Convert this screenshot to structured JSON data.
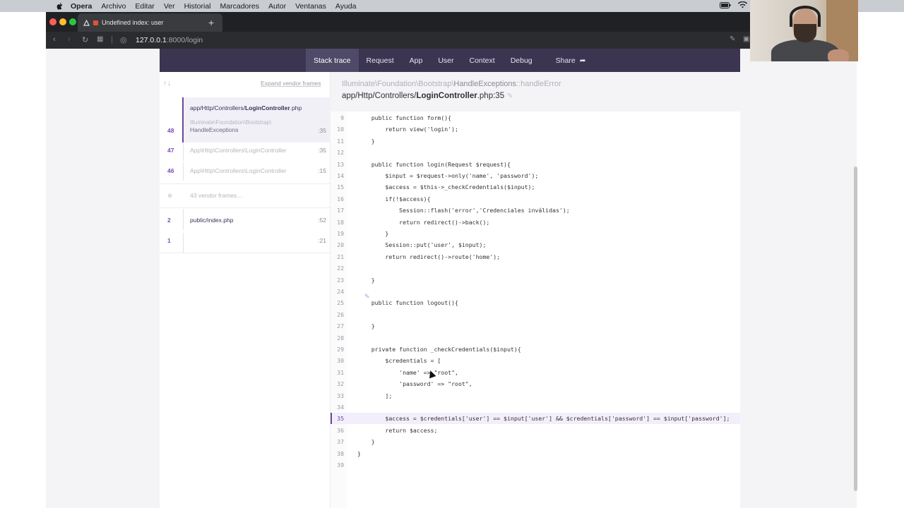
{
  "menubar": {
    "items": [
      "Opera",
      "Archivo",
      "Editar",
      "Ver",
      "Historial",
      "Marcadores",
      "Autor",
      "Ventanas",
      "Ayuda"
    ]
  },
  "browser": {
    "tab_title": "Undefined index: user",
    "new_tab": "+",
    "url_host": "127.0.0.1",
    "url_path": ":8000/login"
  },
  "ignition": {
    "tabs": [
      "Stack trace",
      "Request",
      "App",
      "User",
      "Context",
      "Debug",
      "Share"
    ],
    "active_tab": "Stack trace",
    "expand_label": "Expand vendor frames",
    "frames": [
      {
        "num": "48",
        "file_prefix": "app/Http/Controllers/",
        "file_bold": "LoginController",
        "file_ext": ".php",
        "class_line1": "Illuminate\\Foundation\\Bootstrap\\",
        "class_line2": "HandleExceptions",
        "line": ":35"
      },
      {
        "num": "47",
        "cls": "App\\Http\\Controllers\\LoginController",
        "line": ":35"
      },
      {
        "num": "46",
        "cls": "App\\Http\\Controllers\\LoginController",
        "line": ":15"
      },
      {
        "num": "",
        "cls": "43 vendor frames…",
        "line": ""
      },
      {
        "num": "2",
        "file_prefix": "public/",
        "file_bold": "index",
        "file_ext": ".php",
        "line": ":52"
      },
      {
        "num": "1",
        "cls": "",
        "line": ":21"
      }
    ],
    "crumb_prefix": "Illuminate\\Foundation\\Bootstrap\\",
    "crumb_class": "HandleExceptions",
    "crumb_method": "::handleError",
    "path_prefix": "app/Http/Controllers/",
    "path_bold": "LoginController",
    "path_suffix": ".php:35"
  },
  "code": {
    "highlight_line": 35,
    "lines": [
      {
        "n": "9",
        "t": "    public function form(){"
      },
      {
        "n": "10",
        "t": "        return view('login');"
      },
      {
        "n": "11",
        "t": "    }"
      },
      {
        "n": "12",
        "t": ""
      },
      {
        "n": "13",
        "t": "    public function login(Request $request){"
      },
      {
        "n": "14",
        "t": "        $input = $request->only('name', 'password');"
      },
      {
        "n": "15",
        "t": "        $access = $this->_checkCredentials($input);"
      },
      {
        "n": "16",
        "t": "        if(!$access){"
      },
      {
        "n": "17",
        "t": "            Session::flash('error','Credenciales inválidas');"
      },
      {
        "n": "18",
        "t": "            return redirect()->back();"
      },
      {
        "n": "19",
        "t": "        }"
      },
      {
        "n": "20",
        "t": "        Session::put('user', $input);"
      },
      {
        "n": "21",
        "t": "        return redirect()->route('home');"
      },
      {
        "n": "22",
        "t": ""
      },
      {
        "n": "23",
        "t": "    }"
      },
      {
        "n": "24",
        "t": ""
      },
      {
        "n": "25",
        "t": "    public function logout(){"
      },
      {
        "n": "26",
        "t": ""
      },
      {
        "n": "27",
        "t": "    }"
      },
      {
        "n": "28",
        "t": ""
      },
      {
        "n": "29",
        "t": "    private function _checkCredentials($input){"
      },
      {
        "n": "30",
        "t": "        $credentials = ["
      },
      {
        "n": "31",
        "t": "            'name' => \"root\","
      },
      {
        "n": "32",
        "t": "            'password' => \"root\","
      },
      {
        "n": "33",
        "t": "        ];"
      },
      {
        "n": "34",
        "t": ""
      },
      {
        "n": "35",
        "t": "        $access = $credentials['user'] == $input['user'] && $credentials['password'] == $input['password'];"
      },
      {
        "n": "36",
        "t": "        return $access;"
      },
      {
        "n": "37",
        "t": "    }"
      },
      {
        "n": "38",
        "t": "}"
      },
      {
        "n": "39",
        "t": ""
      }
    ]
  },
  "colors": {
    "nav_bg": "#3b3551",
    "accent": "#6a4a9a"
  }
}
